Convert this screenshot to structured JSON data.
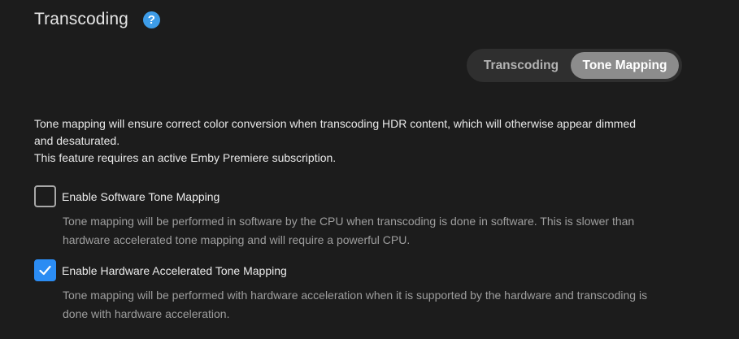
{
  "header": {
    "title": "Transcoding",
    "help_icon": "help-circle-icon"
  },
  "tabs": [
    {
      "label": "Transcoding",
      "active": false
    },
    {
      "label": "Tone Mapping",
      "active": true
    }
  ],
  "description": {
    "line1": "Tone mapping will ensure correct color conversion when transcoding HDR content, which will otherwise appear dimmed and desaturated.",
    "line2": "This feature requires an active Emby Premiere subscription."
  },
  "options": [
    {
      "label": "Enable Software Tone Mapping",
      "checked": false,
      "description": "Tone mapping will be performed in software by the CPU when transcoding is done in software. This is slower than hardware accelerated tone mapping and will require a powerful CPU."
    },
    {
      "label": "Enable Hardware Accelerated Tone Mapping",
      "checked": true,
      "description": "Tone mapping will be performed with hardware acceleration when it is supported by the hardware and transcoding is done with hardware acceleration."
    }
  ],
  "colors": {
    "background": "#1c1c1c",
    "accent": "#2b8cf3",
    "help_icon": "#3d9ce8",
    "tab_active": "#8c8c8c"
  }
}
